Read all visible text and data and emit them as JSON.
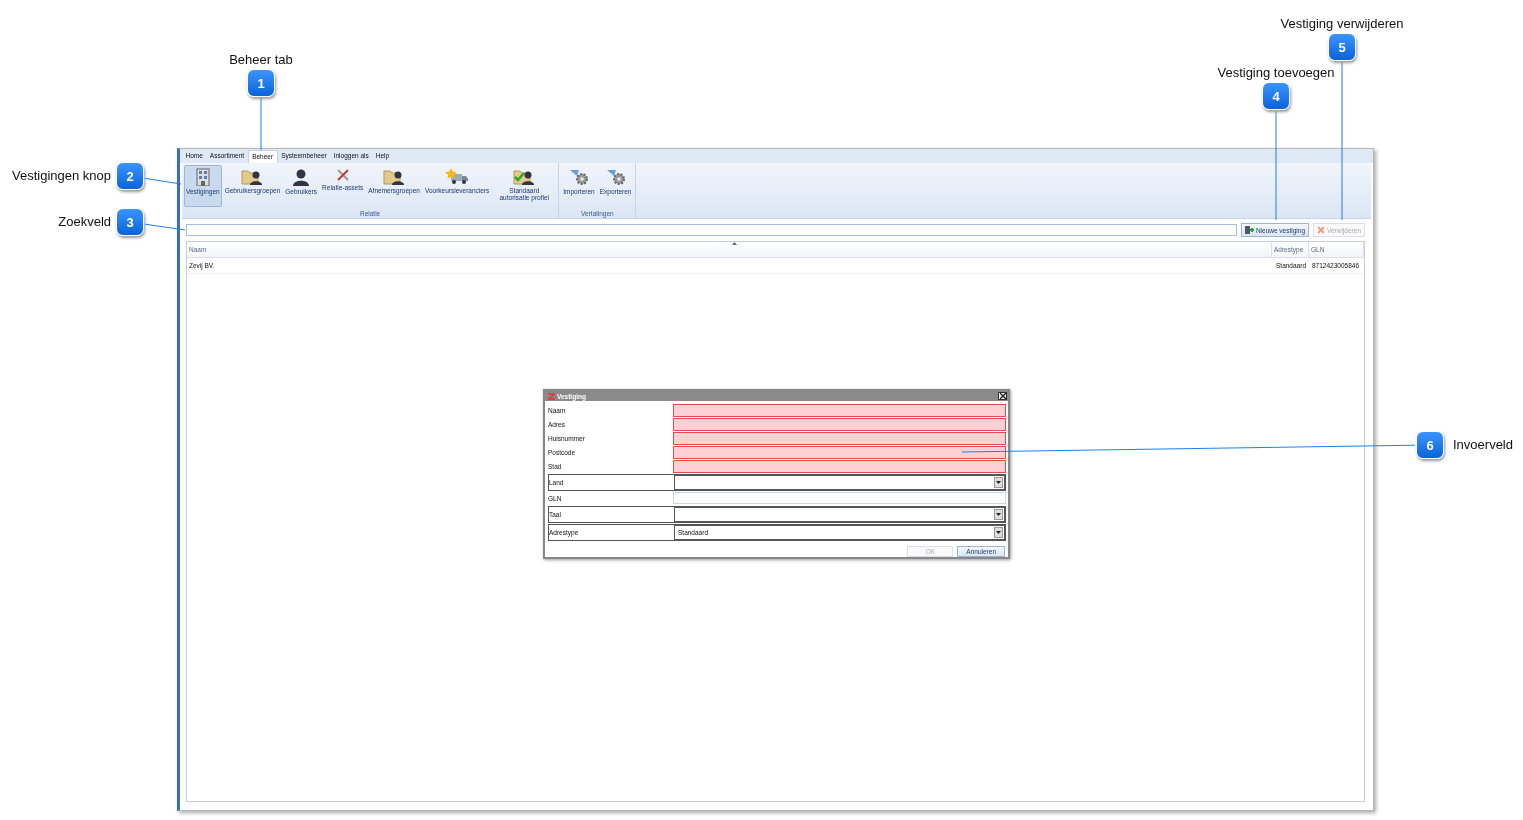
{
  "callouts": [
    {
      "number": "1",
      "label": "Beheer tab"
    },
    {
      "number": "2",
      "label": "Vestigingen knop"
    },
    {
      "number": "3",
      "label": "Zoekveld"
    },
    {
      "number": "4",
      "label": "Vestiging toevoegen"
    },
    {
      "number": "5",
      "label": "Vestiging verwijderen"
    },
    {
      "number": "6",
      "label": "Invoerveld"
    }
  ],
  "menu_tabs": [
    {
      "label": "Home",
      "selected": false
    },
    {
      "label": "Assortiment",
      "selected": false
    },
    {
      "label": "Beheer",
      "selected": true
    },
    {
      "label": "Systeembeheer",
      "selected": false
    },
    {
      "label": "Inloggen als",
      "selected": false
    },
    {
      "label": "Help",
      "selected": false
    }
  ],
  "ribbon_groups": [
    {
      "label": "Relatie",
      "buttons": [
        {
          "label": "Vestigingen",
          "selected": true
        },
        {
          "label": "Gebruikersgroepen",
          "selected": false
        },
        {
          "label": "Gebruikers",
          "selected": false
        },
        {
          "label": "Relatie-assets",
          "selected": false
        },
        {
          "label": "Afnemersgroepen",
          "selected": false
        },
        {
          "label": "Voorkeursleveranciers",
          "selected": false
        },
        {
          "label": "Standaard autorisatie profiel",
          "selected": false
        }
      ]
    },
    {
      "label": "Vertalingen",
      "buttons": [
        {
          "label": "Importeren",
          "selected": false
        },
        {
          "label": "Exporteren",
          "selected": false
        }
      ]
    }
  ],
  "toolbar_buttons": [
    {
      "label": "Nieuwe vestiging",
      "disabled": false
    },
    {
      "label": "Verwijderen",
      "disabled": true
    }
  ],
  "table": {
    "columns": [
      "Naam",
      "Adrestype",
      "GLN"
    ],
    "rows": [
      [
        "Zevij BV.",
        "Standaard",
        "8712423005846"
      ]
    ]
  },
  "dialog": {
    "title": "Vestiging",
    "fields": [
      {
        "label": "Naam",
        "kind": "text",
        "invalid": true
      },
      {
        "label": "Adres",
        "kind": "text",
        "invalid": true
      },
      {
        "label": "Huisnummer",
        "kind": "text",
        "invalid": true
      },
      {
        "label": "Postcode",
        "kind": "text",
        "invalid": true
      },
      {
        "label": "Stad",
        "kind": "text",
        "invalid": true
      },
      {
        "label": "Land",
        "kind": "combo"
      },
      {
        "label": "GLN",
        "kind": "text",
        "invalid": false
      },
      {
        "label": "Taal",
        "kind": "combo"
      },
      {
        "label": "Adrestype",
        "kind": "combo",
        "value": "Standaard"
      }
    ],
    "buttons": [
      {
        "label": "OK",
        "disabled": true
      },
      {
        "label": "Annuleren",
        "disabled": false
      }
    ]
  }
}
